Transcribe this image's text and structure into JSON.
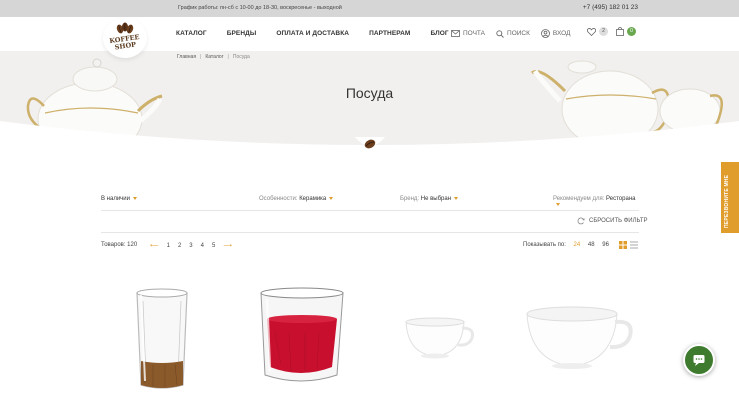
{
  "topbar": {
    "hours": "График работы: пн-сб с 10-00 до 18-30, воскресенье - выходной",
    "phone": "+7 (495) 182 01 23"
  },
  "logo": {
    "line1": "KOFFEE",
    "line2": "SHOP"
  },
  "nav": {
    "items": [
      "КАТАЛОГ",
      "БРЕНДЫ",
      "ОПЛАТА И ДОСТАВКА",
      "ПАРТНЕРАМ",
      "БЛОГ"
    ]
  },
  "actions": {
    "mail": "ПОЧТА",
    "search": "ПОИСК",
    "login": "ВХОД"
  },
  "counters": {
    "favorites": "2",
    "cart": "0"
  },
  "breadcrumb": {
    "home": "Главная",
    "catalog": "Каталог",
    "current": "Посуда"
  },
  "page": {
    "title": "Посуда"
  },
  "filters": {
    "availability": "В наличии",
    "features_label": "Особенности:",
    "features_value": "Керамика",
    "brand_label": "Бренд:",
    "brand_value": "Не выбран",
    "recommended_label": "Рекомендуем для:",
    "recommended_value": "Ресторана",
    "reset": "СБРОСИТЬ ФИЛЬТР"
  },
  "pager": {
    "count_label": "Товаров: 120",
    "pages": [
      "1",
      "2",
      "3",
      "4",
      "5"
    ],
    "per_page_label": "Показывать по:",
    "per_page_options": [
      "24",
      "48",
      "96"
    ],
    "per_page_active": "24"
  },
  "side": {
    "callback": "ПЕРЕЗВОНИТЕ МНЕ"
  },
  "colors": {
    "accent": "#e09d2c",
    "green": "#6aa84f",
    "chat": "#3e7b2e"
  }
}
